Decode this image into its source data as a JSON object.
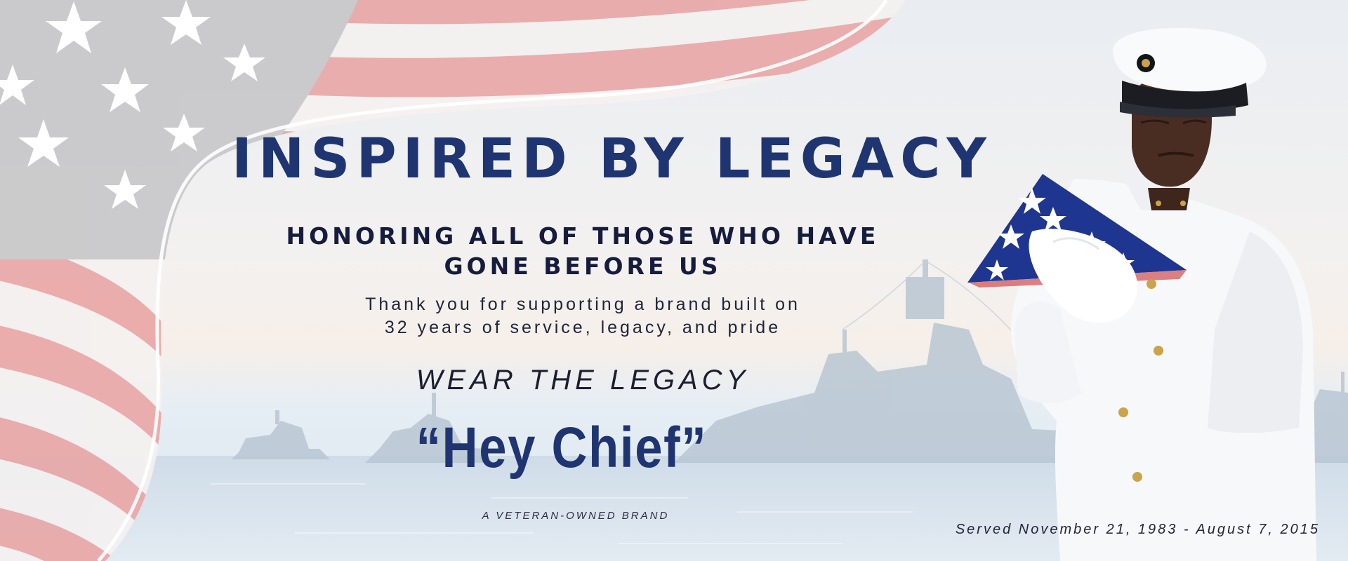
{
  "banner": {
    "headline": "INSPIRED BY LEGACY",
    "subheadline": "HONORING ALL OF THOSE WHO HAVE GONE BEFORE US",
    "thanks_line_1": "Thank you for supporting a brand built on",
    "thanks_line_2": "32 years of service, legacy, and pride",
    "tagline": "WEAR THE LEGACY",
    "brand_quote": "“Hey Chief”",
    "veteran_owned": "A VETERAN-OWNED BRAND",
    "service_dates": "Served November 21, 1983 - August 7, 2015"
  },
  "colors": {
    "navy": "#1f3571",
    "dark_text": "#161c3d",
    "flag_red": "#e9a6a6",
    "flag_canton": "#c7c7c9",
    "uniform_white": "#f7f8fa",
    "folded_flag_blue": "#1f3690"
  },
  "imagery": {
    "background": "waving-american-flag-and-navy-ships-at-sea",
    "figure": "navy-chief-in-white-dress-uniform-holding-folded-flag"
  }
}
